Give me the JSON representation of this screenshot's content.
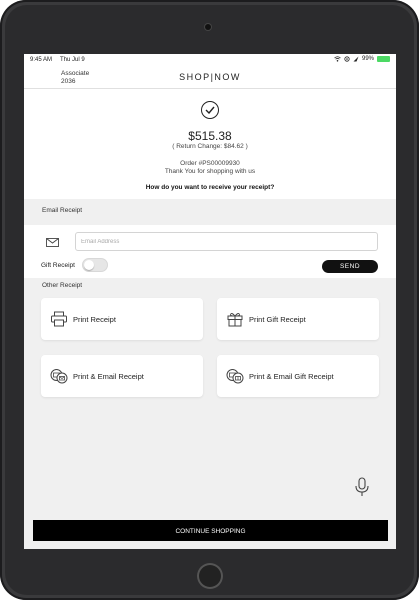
{
  "status_bar": {
    "time": "9:45 AM",
    "date": "Thu Jul 9",
    "battery": "99%",
    "icons": [
      "wifi-icon",
      "location-icon",
      "signal-icon",
      "battery-icon"
    ]
  },
  "header": {
    "associate_label": "Associate",
    "associate_id": "2036",
    "logo": "SHOP|NOW"
  },
  "summary": {
    "total": "$515.38",
    "return_change": "( Return Change: $84.62 )",
    "order": "Order #PS00009930",
    "thanks": "Thank You for shopping with us",
    "question": "How do you want to receive your receipt?"
  },
  "email_receipt": {
    "section_label": "Email Receipt",
    "input_placeholder": "Email Address",
    "input_value": "",
    "gift_receipt_label": "Gift Receipt",
    "gift_receipt_on": false,
    "send_label": "SEND"
  },
  "other_receipt": {
    "section_label": "Other Receipt",
    "options": [
      {
        "label": "Print Receipt",
        "icon": "printer-icon"
      },
      {
        "label": "Print Gift Receipt",
        "icon": "gift-icon"
      },
      {
        "label": "Print & Email Receipt",
        "icon": "print-email-icon"
      },
      {
        "label": "Print & Email Gift Receipt",
        "icon": "print-email-gift-icon"
      }
    ]
  },
  "footer": {
    "continue_label": "CONTINUE SHOPPING",
    "mic_icon": "microphone-icon"
  },
  "colors": {
    "accent": "#000000",
    "background": "#f0f0f0",
    "battery": "#4cd964"
  }
}
